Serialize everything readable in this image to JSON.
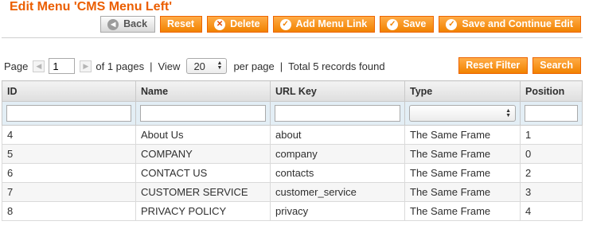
{
  "header": {
    "title": "Edit Menu 'CMS Menu Left'"
  },
  "toolbar": {
    "back_label": "Back",
    "reset_label": "Reset",
    "delete_label": "Delete",
    "add_link_label": "Add Menu Link",
    "save_label": "Save",
    "save_continue_label": "Save and Continue Edit"
  },
  "pager": {
    "page_label": "Page",
    "page_value": "1",
    "of_pages": "of 1 pages",
    "sep1": "|",
    "view_label": "View",
    "view_value": "20",
    "per_page": "per page",
    "sep2": "|",
    "total": "Total 5 records found",
    "reset_filter_label": "Reset Filter",
    "search_label": "Search"
  },
  "grid": {
    "columns": [
      "ID",
      "Name",
      "URL Key",
      "Type",
      "Position"
    ],
    "rows": [
      [
        "4",
        "About Us",
        "about",
        "The Same Frame",
        "1"
      ],
      [
        "5",
        "COMPANY",
        "company",
        "The Same Frame",
        "0"
      ],
      [
        "6",
        "CONTACT US",
        "contacts",
        "The Same Frame",
        "2"
      ],
      [
        "7",
        "CUSTOMER SERVICE",
        "customer_service",
        "The Same Frame",
        "3"
      ],
      [
        "8",
        "PRIVACY POLICY",
        "privacy",
        "The Same Frame",
        "4"
      ]
    ]
  },
  "colors": {
    "accent": "#eb5e00",
    "button": "#f18200",
    "filter_row": "#e3eef5"
  },
  "icons": {
    "back": "arrow-left-icon",
    "delete": "close-circle-icon",
    "confirm": "check-circle-icon",
    "stepper": "updown-icon"
  }
}
